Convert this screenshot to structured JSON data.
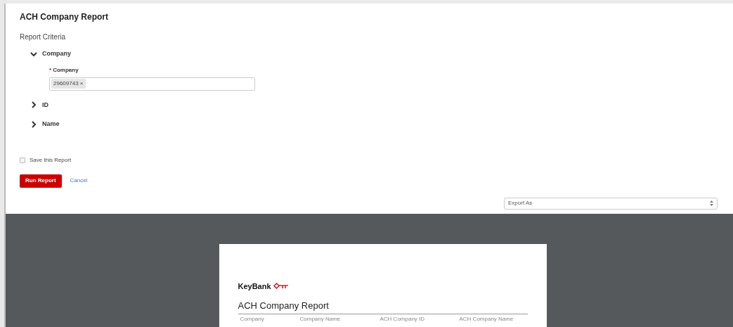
{
  "title": "ACH Company Report",
  "criteria": {
    "heading": "Report Criteria",
    "sections": [
      {
        "label": "Company",
        "expanded": true,
        "field": {
          "label": "Company",
          "required": true,
          "asterisk": "*",
          "tags": [
            "29609743"
          ],
          "remove": "×"
        }
      },
      {
        "label": "ID",
        "expanded": false
      },
      {
        "label": "Name",
        "expanded": false
      }
    ]
  },
  "save": {
    "label": "Save this Report",
    "checked": false
  },
  "buttons": {
    "run": "Run Report",
    "cancel": "Cancel"
  },
  "export": {
    "placeholder": "Export As"
  },
  "preview": {
    "logo": "KeyBank",
    "title": "ACH Company Report",
    "columns": [
      "Company",
      "Company Name",
      "ACH Company ID",
      "ACH Company Name"
    ]
  }
}
